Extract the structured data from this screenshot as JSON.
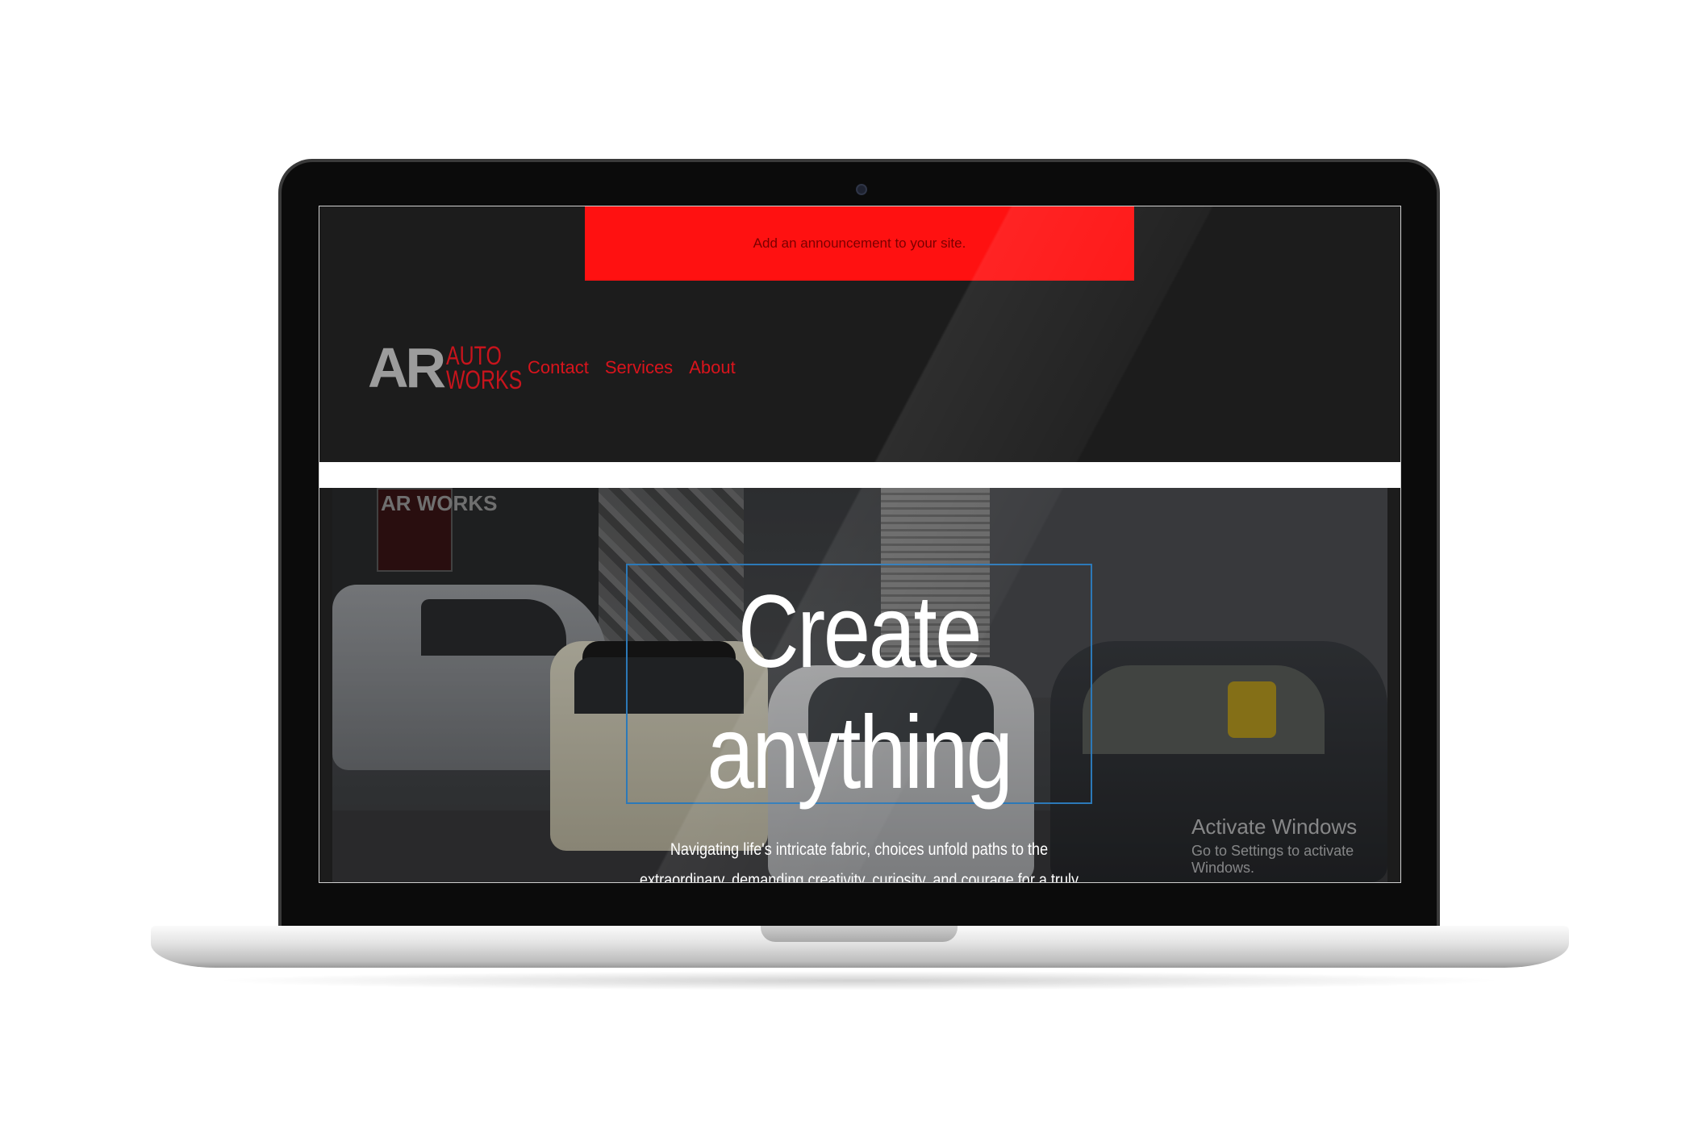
{
  "announcement": {
    "text": "Add an announcement to your site."
  },
  "logo": {
    "mark": "AR",
    "line1": "AUTO",
    "line2": "WORKS"
  },
  "nav": {
    "contact": "Contact",
    "services": "Services",
    "about": "About"
  },
  "hero": {
    "sign_text": "AR WORKS",
    "title_line1": "Create",
    "title_line2": "anything",
    "text": "Navigating life's intricate fabric, choices unfold paths to the extraordinary, demanding creativity, curiosity, and courage for a truly fulfilling journey."
  },
  "watermark": {
    "title": "Activate Windows",
    "subtitle": "Go to Settings to activate Windows."
  },
  "colors": {
    "announcement_bg": "#ff1111",
    "brand_red": "#d9141c",
    "header_bg": "#1c1c1c",
    "title_box_border": "#2c79b8"
  }
}
